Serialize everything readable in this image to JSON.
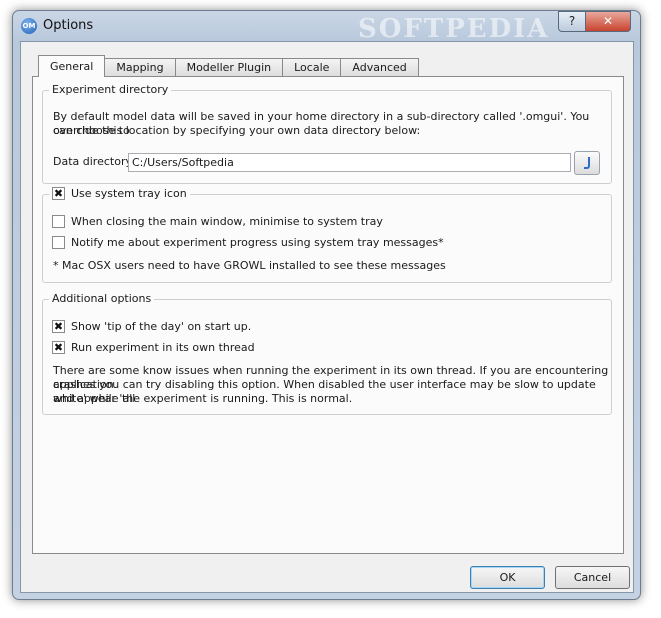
{
  "window": {
    "title": "Options",
    "app_icon": "OM",
    "watermark": "SOFTPEDIA",
    "help_label": "?",
    "close_label": "✕"
  },
  "tabs": [
    {
      "label": "General",
      "active": true
    },
    {
      "label": "Mapping",
      "active": false
    },
    {
      "label": "Modeller Plugin",
      "active": false
    },
    {
      "label": "Locale",
      "active": false
    },
    {
      "label": "Advanced",
      "active": false
    }
  ],
  "experiment_directory": {
    "legend": "Experiment directory",
    "description_line1": "By default model data will be saved in your home directory in a sub-directory called '.omgui'. You can choose to",
    "description_line2": "override this location by specifying your own data directory below:",
    "field_label": "Data directory",
    "field_value": "C:/Users/Softpedia",
    "browse_icon": "folder-browse-icon"
  },
  "system_tray": {
    "legend_checkbox": {
      "label": "Use system tray icon",
      "checked": true
    },
    "options": [
      {
        "label": "When closing the main window, minimise to system tray",
        "checked": false
      },
      {
        "label": "Notify me about experiment progress using system tray messages*",
        "checked": false
      }
    ],
    "footnote": "* Mac OSX users need to have GROWL installed to see these messages"
  },
  "additional_options": {
    "legend": "Additional options",
    "options": [
      {
        "label": "Show 'tip of the day' on start up.",
        "checked": true
      },
      {
        "label": "Run experiment in its own thread",
        "checked": true
      }
    ],
    "note_line1": "There are some know issues when running the experiment in its own thread. If you are encountering application",
    "note_line2": "crashes you can try disabling this option. When disabled the user interface may be slow to update and appear 'all",
    "note_line3": "white' while the experiment is running. This is normal."
  },
  "buttons": {
    "ok": "OK",
    "cancel": "Cancel"
  },
  "check_mark": "✖"
}
